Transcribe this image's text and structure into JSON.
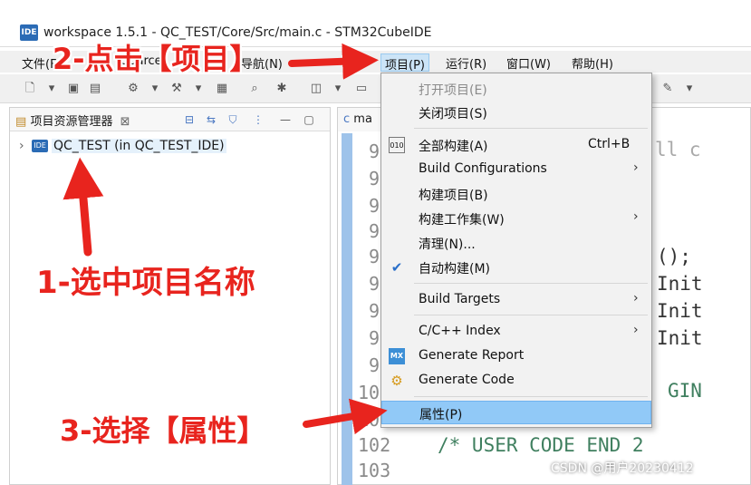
{
  "window": {
    "app_icon": "IDE",
    "title": "workspace 1.5.1 - QC_TEST/Core/Src/main.c - STM32CubeIDE"
  },
  "menubar": {
    "items": [
      {
        "label": "文件(F)"
      },
      {
        "label": "Source"
      },
      {
        "label": "导航(N)"
      },
      {
        "label": "项目(P)",
        "active": true
      },
      {
        "label": "运行(R)"
      },
      {
        "label": "窗口(W)"
      },
      {
        "label": "帮助(H)"
      }
    ]
  },
  "left_pane": {
    "title": "项目资源管理器",
    "close": "⊠",
    "tree": [
      {
        "label": "QC_TEST (in QC_TEST_IDE)",
        "icon": "ide-project-icon"
      }
    ]
  },
  "editor": {
    "tab": "ma",
    "line_numbers": [
      "9",
      "9",
      "9",
      "9",
      "9",
      "9",
      "9",
      "9",
      "9",
      "10",
      "10",
      "102",
      "103"
    ],
    "code_fragments": [
      "ll c",
      "();",
      "Init",
      "Init",
      "Init",
      "GIN",
      "/* USER CODE END 2"
    ]
  },
  "context_menu": {
    "items": [
      {
        "label": "打开项目(E)",
        "disabled": true
      },
      {
        "label": "关闭项目(S)"
      },
      {
        "label": "全部构建(A)",
        "shortcut": "Ctrl+B",
        "icon": "build-all-icon"
      },
      {
        "label": "Build Configurations",
        "submenu": true
      },
      {
        "label": "构建项目(B)"
      },
      {
        "label": "构建工作集(W)",
        "submenu": true
      },
      {
        "label": "清理(N)..."
      },
      {
        "label": "自动构建(M)",
        "checked": true
      },
      {
        "label": "Build Targets",
        "submenu": true
      },
      {
        "label": "C/C++ Index",
        "submenu": true
      },
      {
        "label": "Generate Report",
        "icon": "mx-icon"
      },
      {
        "label": "Generate Code",
        "icon": "gear-code-icon"
      },
      {
        "label": "属性(P)",
        "highlighted": true
      }
    ]
  },
  "annotations": {
    "step1": "1-选中项目名称",
    "step2": "2-点击【项目】",
    "step3": "3-选择【属性】",
    "color": "#e8241e"
  },
  "watermark": "CSDN @用户20230412"
}
